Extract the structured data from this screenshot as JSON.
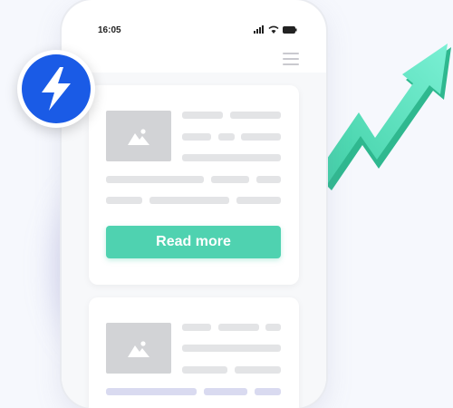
{
  "status_bar": {
    "time": "16:05"
  },
  "card1": {
    "button_label": "Read more"
  },
  "colors": {
    "accent": "#4fd2b0",
    "amp_blue": "#1a5be6",
    "arrow_green": "#58e6c1",
    "placeholder_bar": "#e3e4e6",
    "image_placeholder": "#d2d3d6"
  },
  "icons": {
    "badge": "lightning-bolt-icon",
    "trend": "trend-up-arrow-icon",
    "menu": "hamburger-menu-icon",
    "image": "image-placeholder-icon"
  }
}
